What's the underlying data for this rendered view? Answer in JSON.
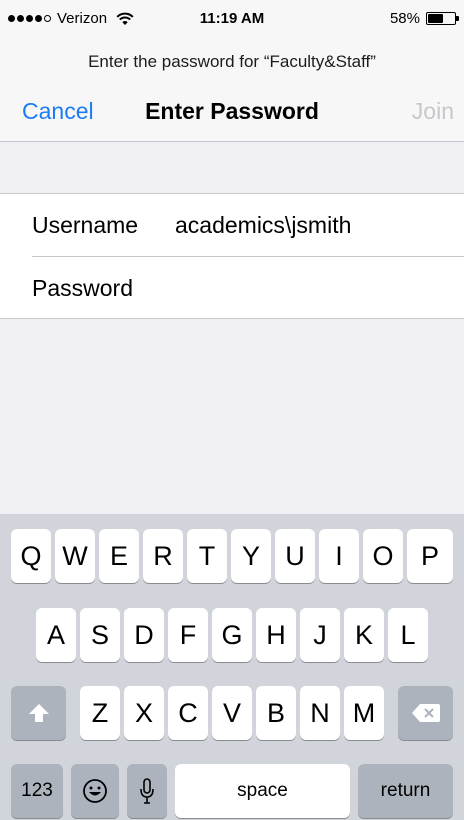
{
  "status_bar": {
    "carrier": "Verizon",
    "time": "11:19 AM",
    "battery_percent": "58%",
    "battery_level": 0.58,
    "signal_bars": 4,
    "signal_max": 5
  },
  "prompt": "Enter the password for “Faculty&Staff”",
  "navbar": {
    "cancel": "Cancel",
    "title": "Enter Password",
    "join": "Join"
  },
  "form": {
    "username_label": "Username",
    "username_value": "academics\\jsmith",
    "password_label": "Password",
    "password_value": ""
  },
  "keyboard": {
    "row1": [
      "Q",
      "W",
      "E",
      "R",
      "T",
      "Y",
      "U",
      "I",
      "O",
      "P"
    ],
    "row2": [
      "A",
      "S",
      "D",
      "F",
      "G",
      "H",
      "J",
      "K",
      "L"
    ],
    "row3": [
      "Z",
      "X",
      "C",
      "V",
      "B",
      "N",
      "M"
    ],
    "numbers_key": "123",
    "space_key": "space",
    "return_key": "return",
    "icons": {
      "shift": "shift-arrow-icon",
      "delete": "backspace-icon",
      "emoji": "emoji-icon",
      "mic": "microphone-icon"
    }
  },
  "colors": {
    "accent": "#1c7cf5",
    "disabled": "#c7c7cc",
    "background": "#efeff4",
    "keyboard": "#d1d5db"
  }
}
